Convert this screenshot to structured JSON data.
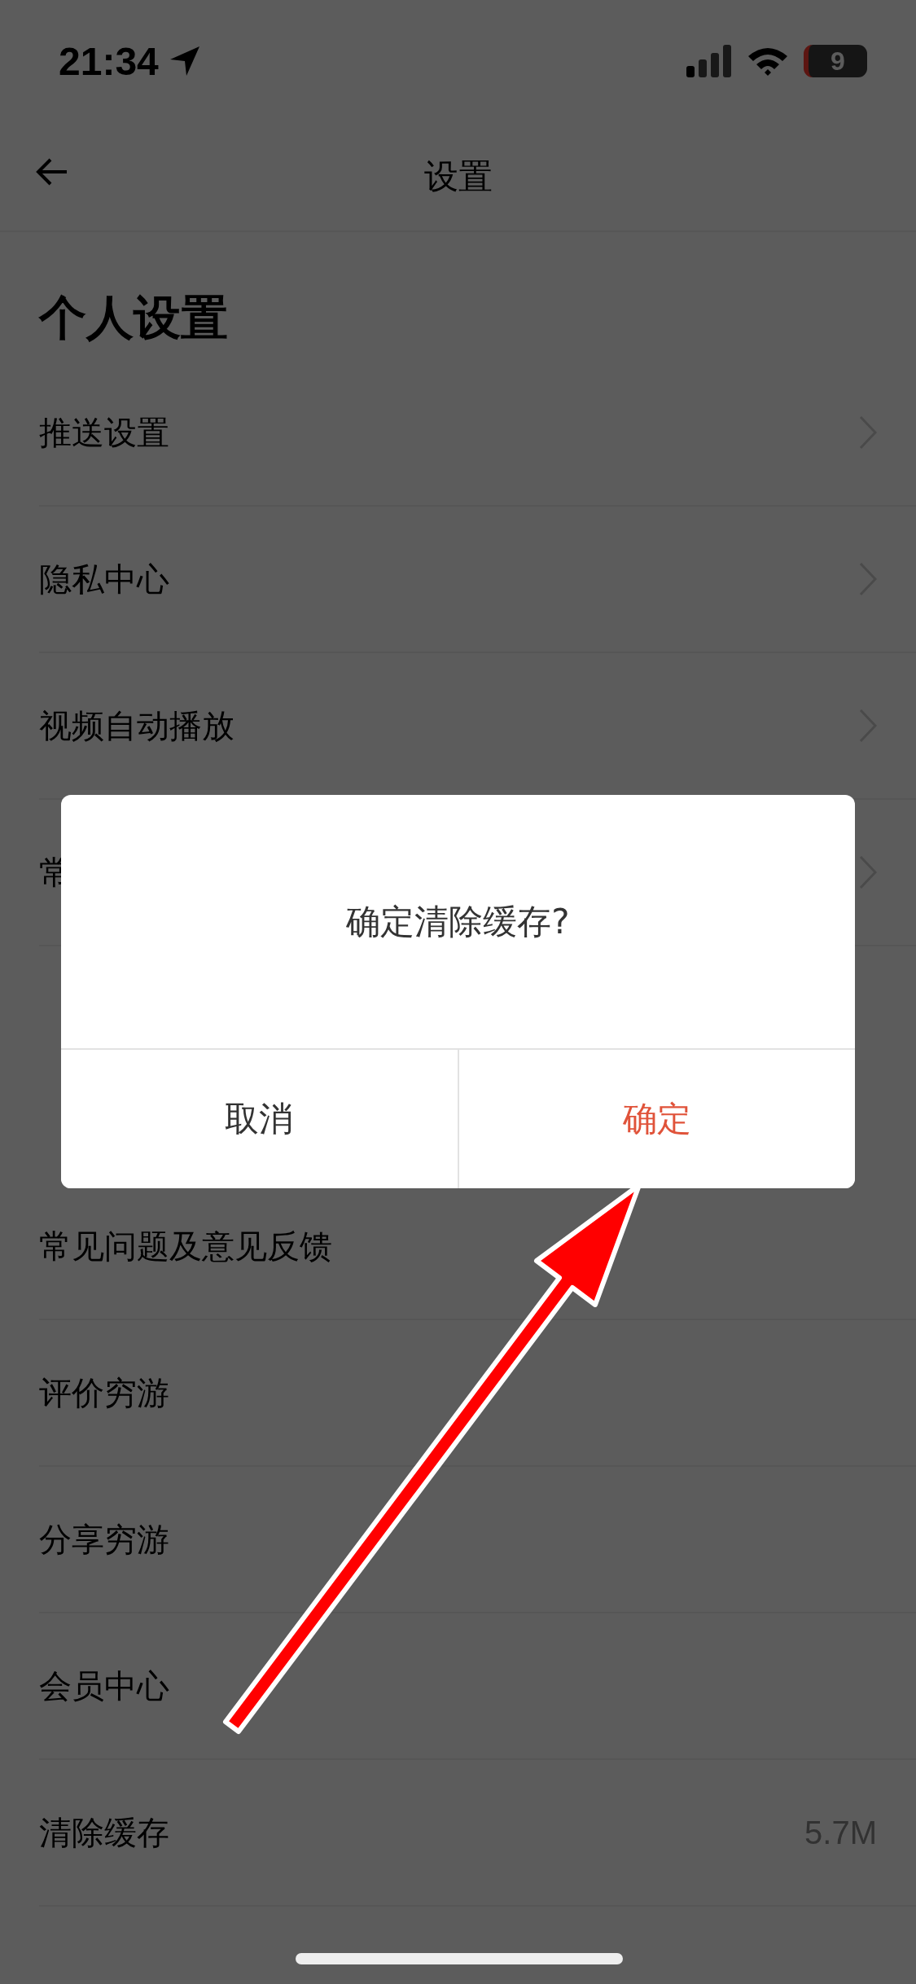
{
  "status_bar": {
    "time": "21:34",
    "battery": "9"
  },
  "nav": {
    "title": "设置"
  },
  "sections": [
    {
      "title": "个人设置",
      "items": [
        {
          "label": "推送设置",
          "kind": "link"
        },
        {
          "label": "隐私中心",
          "kind": "link"
        },
        {
          "label": "视频自动播放",
          "kind": "link"
        },
        {
          "label": "常",
          "kind": "link"
        }
      ]
    },
    {
      "items": [
        {
          "label": "常见问题及意见反馈",
          "kind": "plain"
        },
        {
          "label": "评价穷游",
          "kind": "plain"
        },
        {
          "label": "分享穷游",
          "kind": "plain"
        },
        {
          "label": "会员中心",
          "kind": "plain"
        },
        {
          "label": "清除缓存",
          "kind": "value",
          "value": "5.7M"
        }
      ]
    }
  ],
  "dialog": {
    "message": "确定清除缓存?",
    "buttons": [
      {
        "label": "取消",
        "kind": "cancel"
      },
      {
        "label": "确定",
        "kind": "confirm"
      }
    ]
  }
}
